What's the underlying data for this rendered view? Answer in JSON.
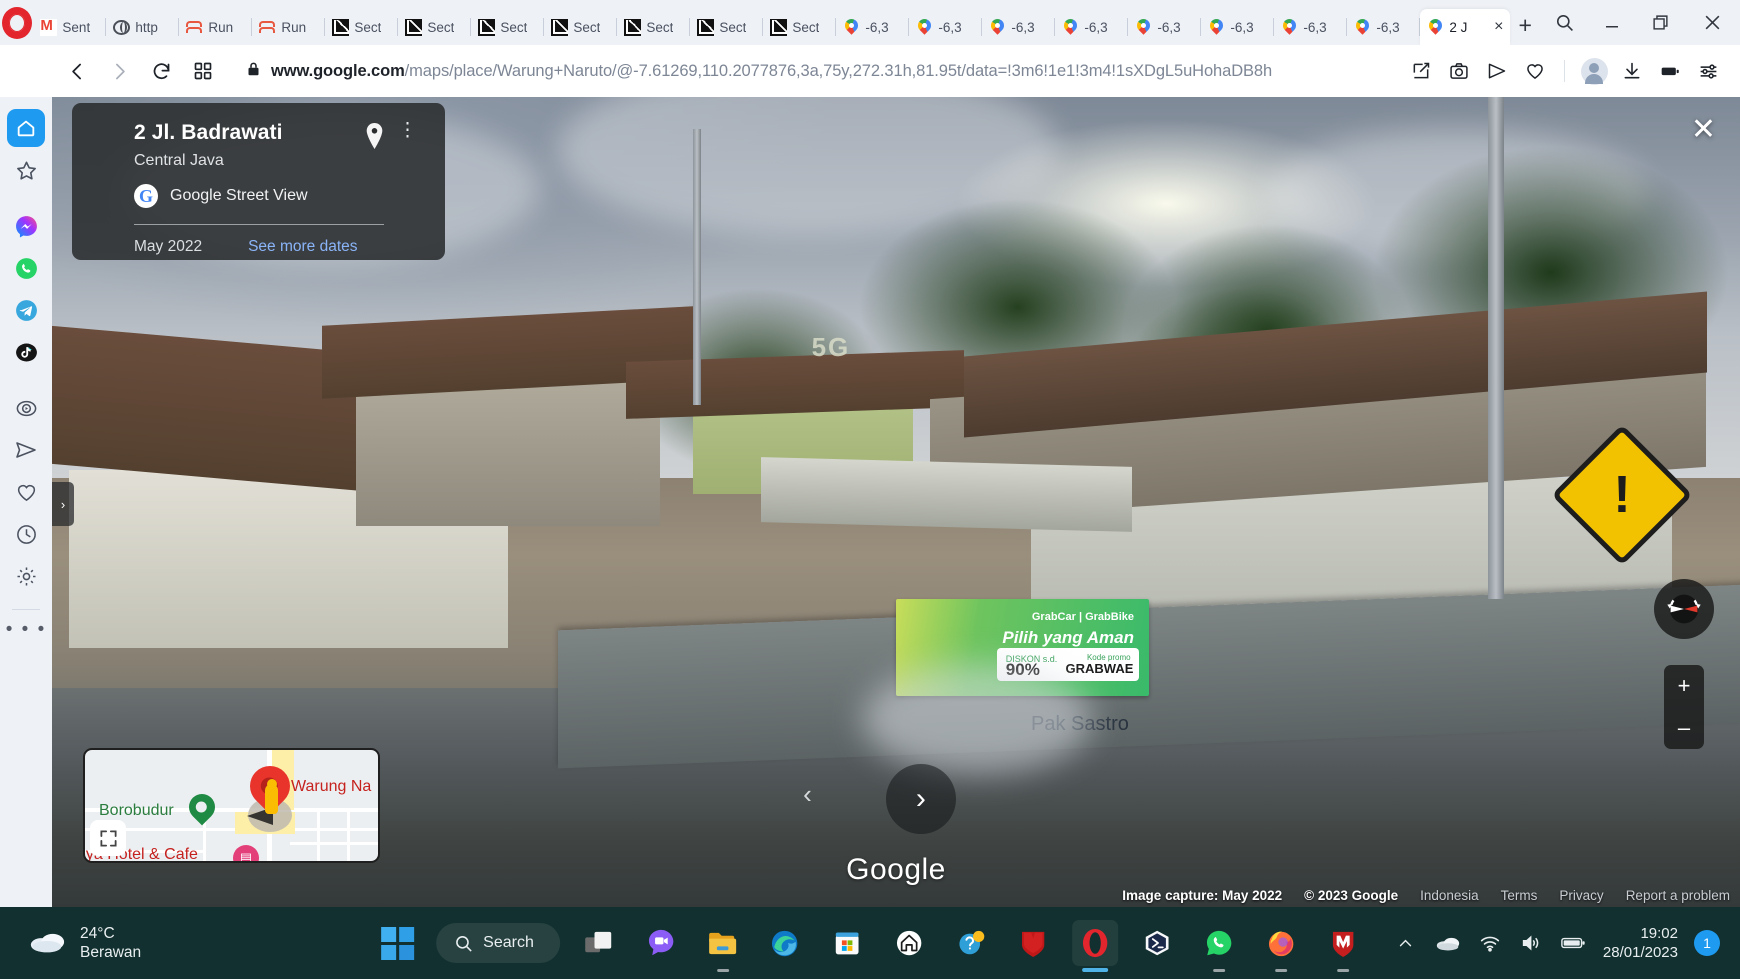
{
  "browser": {
    "tabs": [
      {
        "label": "Sent",
        "icon": "gmail-icon",
        "active": false
      },
      {
        "label": "http",
        "icon": "globe-icon",
        "active": false
      },
      {
        "label": "Run",
        "icon": "chevron-logo-icon",
        "active": false
      },
      {
        "label": "Run",
        "icon": "chevron-logo-icon",
        "active": false
      },
      {
        "label": "Sect",
        "icon": "chart-icon",
        "active": false
      },
      {
        "label": "Sect",
        "icon": "chart-icon",
        "active": false
      },
      {
        "label": "Sect",
        "icon": "chart-icon",
        "active": false
      },
      {
        "label": "Sect",
        "icon": "chart-icon",
        "active": false
      },
      {
        "label": "Sect",
        "icon": "chart-icon",
        "active": false
      },
      {
        "label": "Sect",
        "icon": "chart-icon",
        "active": false
      },
      {
        "label": "Sect",
        "icon": "chart-icon",
        "active": false
      },
      {
        "label": "-6,3",
        "icon": "maps-pin-icon",
        "active": false
      },
      {
        "label": "-6,3",
        "icon": "maps-pin-icon",
        "active": false
      },
      {
        "label": "-6,3",
        "icon": "maps-pin-icon",
        "active": false
      },
      {
        "label": "-6,3",
        "icon": "maps-pin-icon",
        "active": false
      },
      {
        "label": "-6,3",
        "icon": "maps-pin-icon",
        "active": false
      },
      {
        "label": "-6,3",
        "icon": "maps-pin-icon",
        "active": false
      },
      {
        "label": "-6,3",
        "icon": "maps-pin-icon",
        "active": false
      },
      {
        "label": "-6,3",
        "icon": "maps-pin-icon",
        "active": false
      },
      {
        "label": "2 J",
        "icon": "maps-pin-icon",
        "active": true
      }
    ],
    "new_tab_label": "+",
    "window_controls": {
      "search": "search-icon",
      "minimize": "_",
      "maximize": "maximize-icon",
      "close": "close-icon"
    },
    "toolbar": {
      "back": "back-icon",
      "forward": "forward-icon",
      "reload": "reload-icon",
      "tabgrid": "tab-grid-icon",
      "lock": "lock-icon",
      "url_domain": "www.google.com",
      "url_path": "/maps/place/Warung+Naruto/@-7.61269,110.2077876,3a,75y,272.31h,81.95t/data=!3m6!1e1!3m4!1sXDgL5uHohaDB8h",
      "icons": [
        "pin-edit-icon",
        "camera-icon",
        "send-icon",
        "heart-icon",
        "avatar-icon",
        "download-icon",
        "battery-icon",
        "settings-sliders-icon"
      ]
    }
  },
  "sidebar": {
    "items": [
      {
        "name": "home",
        "label": "home-icon",
        "active": true
      },
      {
        "name": "favorites",
        "label": "star-icon",
        "active": false
      },
      {
        "name": "messenger",
        "label": "messenger-icon",
        "active": false
      },
      {
        "name": "whatsapp",
        "label": "whatsapp-icon",
        "active": false
      },
      {
        "name": "telegram",
        "label": "telegram-icon",
        "active": false
      },
      {
        "name": "tiktok",
        "label": "tiktok-icon",
        "active": false
      },
      {
        "name": "player",
        "label": "player-icon",
        "active": false
      },
      {
        "name": "send",
        "label": "send-icon",
        "active": false
      },
      {
        "name": "pinboard",
        "label": "heart-icon",
        "active": false
      },
      {
        "name": "history",
        "label": "history-icon",
        "active": false
      },
      {
        "name": "settings",
        "label": "gear-icon",
        "active": false
      }
    ],
    "more_label": "• • •"
  },
  "streetview": {
    "info_card": {
      "title": "2 Jl. Badrawati",
      "subtitle": "Central Java",
      "source": "Google Street View",
      "source_mark": "G",
      "date": "May 2022",
      "more_dates": "See more dates",
      "pin_icon": "location-pin-icon",
      "menu_icon": "kebab-menu-icon",
      "close_icon": "close-icon"
    },
    "watermark": "Google",
    "nav_forward": "›",
    "nav_back": "‹",
    "expander": "›",
    "scene": {
      "sign_5g": "5G",
      "billboard": {
        "brand": "GrabCar | GrabBike",
        "headline": "Pilih yang Aman",
        "discount_label": "DISKON s.d.",
        "discount_value": "90%",
        "code_label": "Kode promo",
        "code_value": "GRABWAE"
      },
      "shop_sign": "Pak Sastro"
    },
    "compass": "compass-icon",
    "zoom_in": "+",
    "zoom_out": "–",
    "attribution": {
      "capture": "Image capture: May 2022",
      "copyright": "© 2023 Google",
      "links": [
        "Indonesia",
        "Terms",
        "Privacy",
        "Report a problem"
      ]
    },
    "minimap": {
      "labels": [
        {
          "text": "Borobudur",
          "color": "green"
        },
        {
          "text": "Warung Na",
          "color": "red"
        },
        {
          "text": "aya Hotel & Cafe",
          "color": "red"
        }
      ],
      "expand_icon": "fullscreen-icon"
    }
  },
  "taskbar": {
    "weather": {
      "temp": "24°C",
      "condition": "Berawan",
      "icon": "cloud-icon"
    },
    "start_icon": "windows-start-icon",
    "search_label": "Search",
    "apps": [
      {
        "name": "task-view",
        "icon": "task-view-icon",
        "running": false
      },
      {
        "name": "chat",
        "icon": "chat-video-icon",
        "running": false
      },
      {
        "name": "file-explorer",
        "icon": "folder-icon",
        "running": true
      },
      {
        "name": "microsoft-edge",
        "icon": "edge-icon",
        "running": false
      },
      {
        "name": "microsoft-store",
        "icon": "store-icon",
        "running": false
      },
      {
        "name": "home-app",
        "icon": "house-icon",
        "running": false
      },
      {
        "name": "help",
        "icon": "question-icon",
        "running": false
      },
      {
        "name": "mcafee",
        "icon": "mcafee-shield-icon",
        "running": false
      },
      {
        "name": "opera",
        "icon": "opera-icon",
        "running": true
      },
      {
        "name": "powershell",
        "icon": "powershell-icon",
        "running": false
      },
      {
        "name": "whatsapp",
        "icon": "whatsapp-icon",
        "running": true
      },
      {
        "name": "firefox",
        "icon": "firefox-icon",
        "running": true
      },
      {
        "name": "mcafee-2",
        "icon": "mcafee-shield-icon",
        "running": true
      }
    ],
    "tray": [
      "chevron-up-icon",
      "onedrive-cloud-icon",
      "wifi-icon",
      "volume-icon",
      "battery-icon"
    ],
    "clock": {
      "time": "19:02",
      "date": "28/01/2023"
    },
    "notification_count": "1"
  }
}
